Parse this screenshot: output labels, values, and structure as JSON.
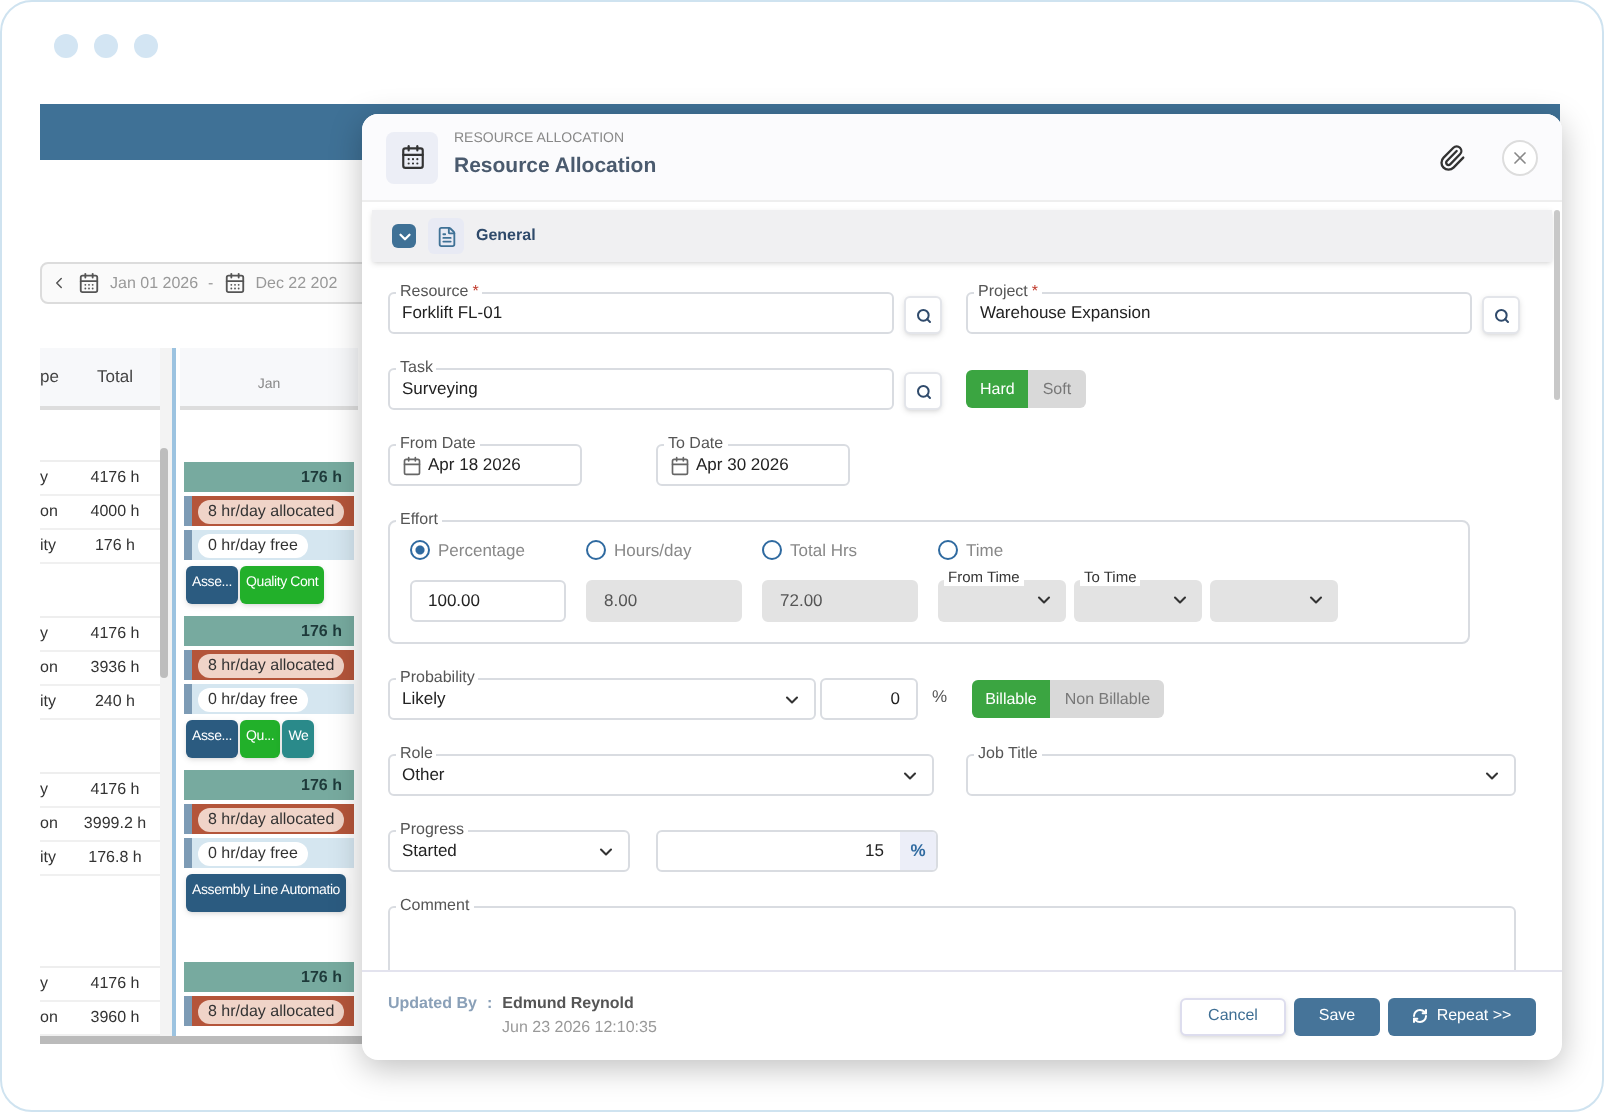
{
  "background": {
    "date_from": "Jan 01 2026",
    "date_separator": "-",
    "date_to": "Dec 22 202",
    "columns": [
      "pe",
      "Total"
    ],
    "timeline_month": "Jan",
    "groups": [
      {
        "rows": [
          {
            "label": "y",
            "total": "4176 h"
          },
          {
            "label": "on",
            "total": "4000 h"
          },
          {
            "label": "ity",
            "total": "176 h"
          }
        ],
        "bars": {
          "total": "176 h",
          "allocated": "8 hr/day allocated",
          "free": "0 hr/day free"
        },
        "tasks": [
          {
            "label": "Asse...",
            "color": "#2b5b80"
          },
          {
            "label": "Quality Cont",
            "color": "#22b02a"
          }
        ]
      },
      {
        "rows": [
          {
            "label": "y",
            "total": "4176 h"
          },
          {
            "label": "on",
            "total": "3936 h"
          },
          {
            "label": "ity",
            "total": "240 h"
          }
        ],
        "bars": {
          "total": "176 h",
          "allocated": "8 hr/day allocated",
          "free": "0 hr/day free"
        },
        "tasks": [
          {
            "label": "Asse...",
            "color": "#2b5b80"
          },
          {
            "label": "Qu...",
            "color": "#22b02a"
          },
          {
            "label": "We",
            "color": "#2a8a8a"
          }
        ]
      },
      {
        "rows": [
          {
            "label": "y",
            "total": "4176 h"
          },
          {
            "label": "on",
            "total": "3999.2 h"
          },
          {
            "label": "ity",
            "total": "176.8 h"
          }
        ],
        "bars": {
          "total": "176 h",
          "allocated": "8 hr/day allocated",
          "free": "0 hr/day free"
        },
        "tasks": [
          {
            "label": "Assembly Line Automatio",
            "color": "#2b5b80"
          }
        ]
      },
      {
        "rows": [
          {
            "label": "y",
            "total": "4176 h"
          },
          {
            "label": "on",
            "total": "3960 h"
          }
        ],
        "bars": {
          "total": "176 h",
          "allocated": "8 hr/day allocated"
        }
      }
    ]
  },
  "modal": {
    "kicker": "RESOURCE ALLOCATION",
    "title": "Resource Allocation",
    "section": {
      "title": "General",
      "expanded": true
    },
    "resource": {
      "label": "Resource",
      "marker": "*",
      "value": "Forklift FL-01"
    },
    "project": {
      "label": "Project",
      "marker": "*",
      "value": "Warehouse Expansion"
    },
    "task": {
      "label": "Task",
      "value": "Surveying"
    },
    "booking_type": [
      {
        "label": "Hard",
        "selected": true
      },
      {
        "label": "Soft",
        "selected": false
      }
    ],
    "from_date": {
      "label": "From Date",
      "value": "Apr 18 2026"
    },
    "to_date": {
      "label": "To Date",
      "value": "Apr 30 2026"
    },
    "effort": {
      "label": "Effort",
      "options": [
        {
          "label": "Percentage",
          "selected": true,
          "value": "100.00",
          "disabled": false
        },
        {
          "label": "Hours/day",
          "selected": false,
          "value": "8.00",
          "disabled": true
        },
        {
          "label": "Total Hrs",
          "selected": false,
          "value": "72.00",
          "disabled": true
        },
        {
          "label": "Time",
          "selected": false
        }
      ],
      "from_time_label": "From Time",
      "to_time_label": "To Time"
    },
    "probability": {
      "label": "Probability",
      "value": "Likely",
      "percent": "0",
      "unit": "%"
    },
    "billing": [
      {
        "label": "Billable",
        "selected": true
      },
      {
        "label": "Non Billable",
        "selected": false
      }
    ],
    "role": {
      "label": "Role",
      "value": "Other"
    },
    "job_title": {
      "label": "Job Title"
    },
    "progress": {
      "label": "Progress",
      "value": "Started",
      "percent": "15",
      "unit": "%"
    },
    "comment": {
      "label": "Comment"
    },
    "footer": {
      "updated_by_label": "Updated By",
      "separator": ":",
      "name": "Edmund Reynold",
      "timestamp": "Jun 23 2026 12:10:35"
    },
    "buttons": [
      {
        "label": "Cancel",
        "kind": "secondary"
      },
      {
        "label": "Save",
        "kind": "primary"
      },
      {
        "label": "Repeat >>",
        "kind": "repeat"
      }
    ]
  }
}
